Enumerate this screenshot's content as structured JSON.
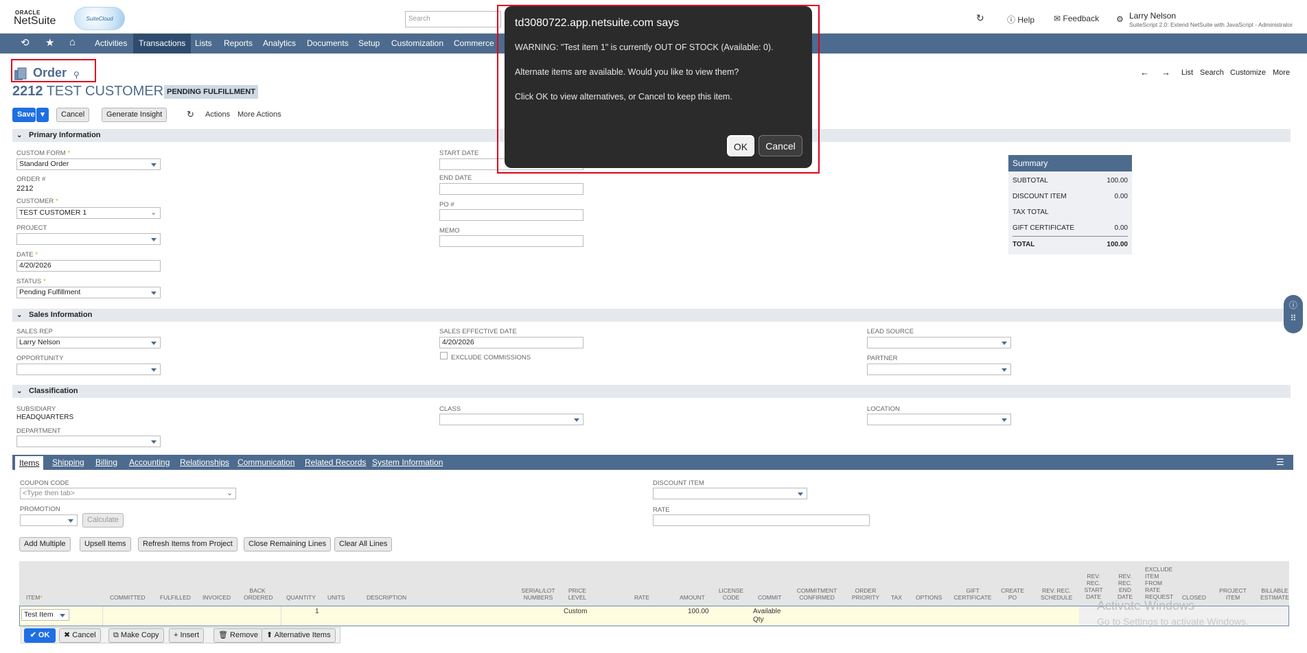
{
  "header": {
    "oracle": "ORACLE",
    "netsuite": "NetSuite",
    "cloud_logo": "SuiteCloud",
    "search_placeholder": "Search",
    "help": "Help",
    "feedback": "Feedback",
    "user_name": "Larry Nelson",
    "user_role": "SuiteScript 2.0: Extend NetSuite with JavaScript - Administrator"
  },
  "nav": {
    "items": [
      "Activities",
      "Transactions",
      "Lists",
      "Reports",
      "Analytics",
      "Documents",
      "Setup",
      "Customization",
      "Commerce"
    ],
    "active": "Transactions"
  },
  "record": {
    "title": "Order",
    "number": "2212",
    "customer": "TEST CUSTOMER 1",
    "status_badge": "PENDING FULFILLMENT",
    "right_links": [
      "List",
      "Search",
      "Customize",
      "More"
    ]
  },
  "toolbar": {
    "save": "Save",
    "cancel": "Cancel",
    "generate_insight": "Generate Insight",
    "actions": "Actions",
    "more_actions": "More Actions"
  },
  "primary": {
    "section": "Primary Information",
    "custom_form_label": "CUSTOM FORM",
    "custom_form": "Standard Order",
    "order_label": "ORDER #",
    "order": "2212",
    "customer_label": "CUSTOMER",
    "customer": "TEST CUSTOMER 1",
    "project_label": "PROJECT",
    "date_label": "DATE",
    "date": "4/20/2026",
    "status_label": "STATUS",
    "status": "Pending Fulfillment",
    "start_date_label": "START DATE",
    "end_date_label": "END DATE",
    "po_label": "PO #",
    "memo_label": "MEMO"
  },
  "summary": {
    "title": "Summary",
    "rows": [
      {
        "label": "SUBTOTAL",
        "value": "100.00"
      },
      {
        "label": "DISCOUNT ITEM",
        "value": "0.00"
      },
      {
        "label": "TAX TOTAL",
        "value": ""
      },
      {
        "label": "GIFT CERTIFICATE",
        "value": "0.00"
      }
    ],
    "total_label": "TOTAL",
    "total": "100.00"
  },
  "sales": {
    "section": "Sales Information",
    "sales_rep_label": "SALES REP",
    "sales_rep": "Larry Nelson",
    "opportunity_label": "OPPORTUNITY",
    "effective_label": "SALES EFFECTIVE DATE",
    "effective": "4/20/2026",
    "exclude_label": "EXCLUDE COMMISSIONS",
    "lead_label": "LEAD SOURCE",
    "partner_label": "PARTNER"
  },
  "classification": {
    "section": "Classification",
    "subsidiary_label": "SUBSIDIARY",
    "subsidiary": "HEADQUARTERS",
    "department_label": "DEPARTMENT",
    "class_label": "CLASS",
    "location_label": "LOCATION"
  },
  "tabs": [
    "Items",
    "Shipping",
    "Billing",
    "Accounting",
    "Relationships",
    "Communication",
    "Related Records",
    "System Information"
  ],
  "items": {
    "coupon_label": "COUPON CODE",
    "coupon_placeholder": "<Type then tab>",
    "promotion_label": "PROMOTION",
    "calculate": "Calculate",
    "discount_label": "DISCOUNT ITEM",
    "rate_label": "RATE",
    "buttons": [
      "Add Multiple",
      "Upsell Items",
      "Refresh Items from Project",
      "Close Remaining Lines",
      "Clear All Lines"
    ],
    "columns": [
      "ITEM",
      "COMMITTED",
      "FULFILLED",
      "INVOICED",
      "BACK ORDERED",
      "QUANTITY",
      "UNITS",
      "DESCRIPTION",
      "SERIAL/LOT NUMBERS",
      "PRICE LEVEL",
      "RATE",
      "AMOUNT",
      "LICENSE CODE",
      "COMMIT",
      "COMMITMENT CONFIRMED",
      "ORDER PRIORITY",
      "TAX",
      "OPTIONS",
      "GIFT CERTIFICATE",
      "CREATE PO",
      "REV. REC. SCHEDULE",
      "REV. REC. START DATE",
      "REV. REC. END DATE",
      "EXCLUDE ITEM FROM RATE REQUEST",
      "CLOSED",
      "PROJECT ITEM",
      "BILLABLE ESTIMATE"
    ],
    "row": {
      "item": "Test Item",
      "quantity": "1",
      "price_level": "Custom",
      "amount": "100.00",
      "commit": "Available Qty"
    },
    "row_buttons": [
      "OK",
      "Cancel",
      "Make Copy",
      "Insert",
      "Remove",
      "Alternative Items"
    ]
  },
  "dialog": {
    "title": "td3080722.app.netsuite.com says",
    "line1": "WARNING: \"Test item 1\" is currently OUT OF STOCK (Available: 0).",
    "line2": "Alternate items are available. Would you like to view them?",
    "line3": "Click OK to view alternatives, or Cancel to keep this item.",
    "ok": "OK",
    "cancel": "Cancel"
  },
  "watermark": {
    "line1": "Activate Windows",
    "line2": "Go to Settings to activate Windows."
  }
}
